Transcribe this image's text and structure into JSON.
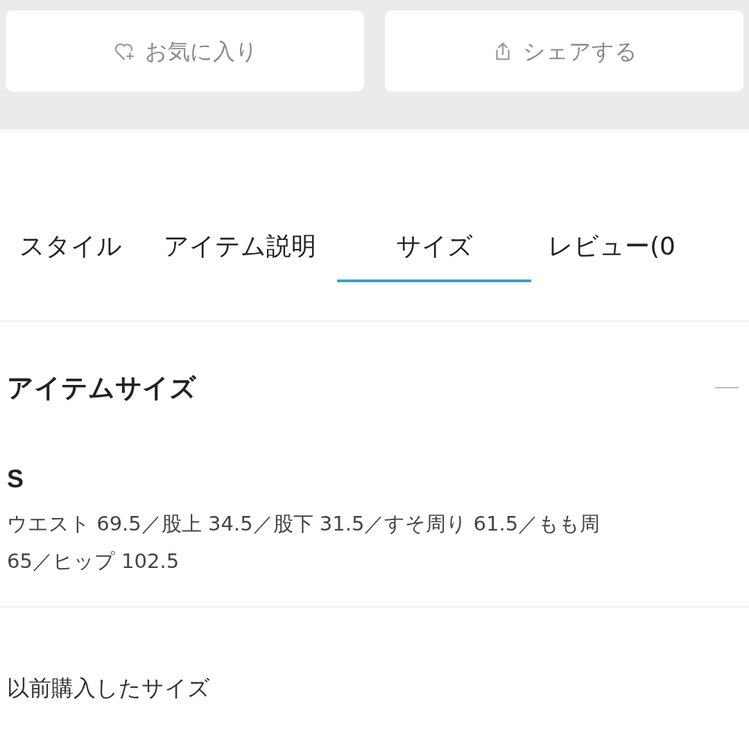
{
  "actions": [
    {
      "kind": "favorite",
      "label": "お気に入り"
    },
    {
      "kind": "share",
      "label": "シェアする"
    }
  ],
  "tabs": [
    {
      "label": "スタイル",
      "selected": false
    },
    {
      "label": "アイテム説明",
      "selected": false
    },
    {
      "label": "サイズ",
      "selected": true
    },
    {
      "label": "レビュー(0",
      "selected": false
    }
  ],
  "section": {
    "title": "アイテムサイズ",
    "expanded": true,
    "size_name": "S",
    "size_lines": [
      "ウエスト 69.5／股上 34.5／股下 31.5／すそ周り 61.5／もも周",
      "65／ヒップ 102.5"
    ]
  },
  "previous": {
    "label": "以前購入したサイズ"
  }
}
